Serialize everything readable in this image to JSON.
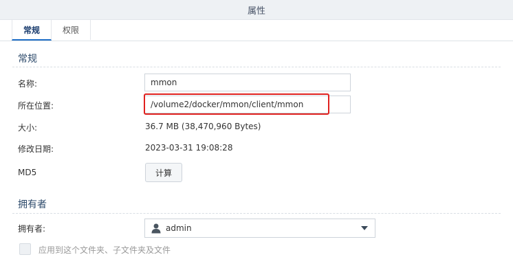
{
  "window": {
    "title": "属性"
  },
  "tabs": [
    {
      "label": "常规",
      "active": true
    },
    {
      "label": "权限",
      "active": false
    }
  ],
  "general": {
    "section_title": "常规",
    "name_label": "名称:",
    "name_value": "mmon",
    "location_label": "所在位置:",
    "location_value": "/volume2/docker/mmon/client/mmon",
    "size_label": "大小:",
    "size_value": "36.7 MB (38,470,960 Bytes)",
    "modified_label": "修改日期:",
    "modified_value": "2023-03-31 19:08:28",
    "md5_label": "MD5",
    "compute_button": "计算"
  },
  "owner": {
    "section_title": "拥有者",
    "owner_label": "拥有者:",
    "owner_value": "admin",
    "owner_icon": "user-icon",
    "apply_label": "应用到这个文件夹、子文件夹及文件"
  },
  "colors": {
    "highlight": "#e0201e",
    "tab_active_underline": "#1e6ec7",
    "section_title": "#2d4a6b"
  }
}
